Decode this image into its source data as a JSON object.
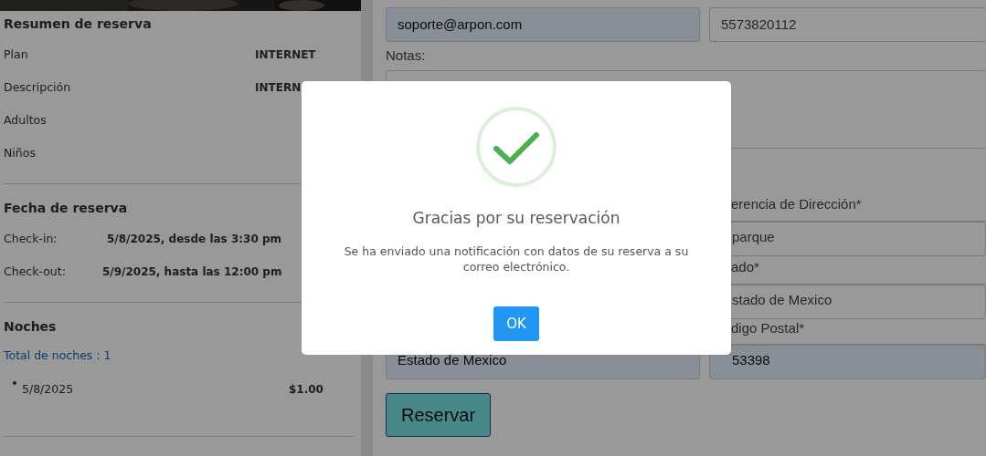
{
  "summary": {
    "title": "Resumen de reserva",
    "rows": [
      {
        "label": "Plan",
        "value": "INTERNET"
      },
      {
        "label": "Descripción",
        "value": "INTERN"
      },
      {
        "label": "Adultos"
      },
      {
        "label": "Niños"
      }
    ]
  },
  "dates": {
    "title": "Fecha de reserva",
    "rows": [
      {
        "label": "Check-in:",
        "value": "5/8/2025, desde las 3:30 pm"
      },
      {
        "label": "Check-out:",
        "value": "5/9/2025, hasta las 12:00 pm"
      }
    ]
  },
  "nights": {
    "title": "Noches",
    "total": "Total de noches : 1",
    "items": [
      {
        "date": "5/8/2025",
        "price": "$1.00"
      }
    ]
  },
  "form": {
    "email": "soporte@arpon.com",
    "phone": "5573820112",
    "notes_label": "Notas:",
    "column_1_items": [
      {
        "kind": "input",
        "value": "Estado de Mexico"
      }
    ],
    "column_2_items": [
      {
        "kind": "label",
        "text": "erencia de Dirección*"
      },
      {
        "kind": "input",
        "value": "parque"
      },
      {
        "kind": "label",
        "text": "ado*"
      },
      {
        "kind": "input",
        "value": "stado de Mexico"
      },
      {
        "kind": "label",
        "text": "digo Postal*"
      },
      {
        "kind": "input",
        "value": "53398",
        "autofilled": true
      }
    ],
    "button": "Reservar"
  },
  "dialog": {
    "title": "Gracias por su reservación",
    "message": "Se ha enviado una notificación con datos de su reserva a su correo electrónico.",
    "button": "OK"
  }
}
